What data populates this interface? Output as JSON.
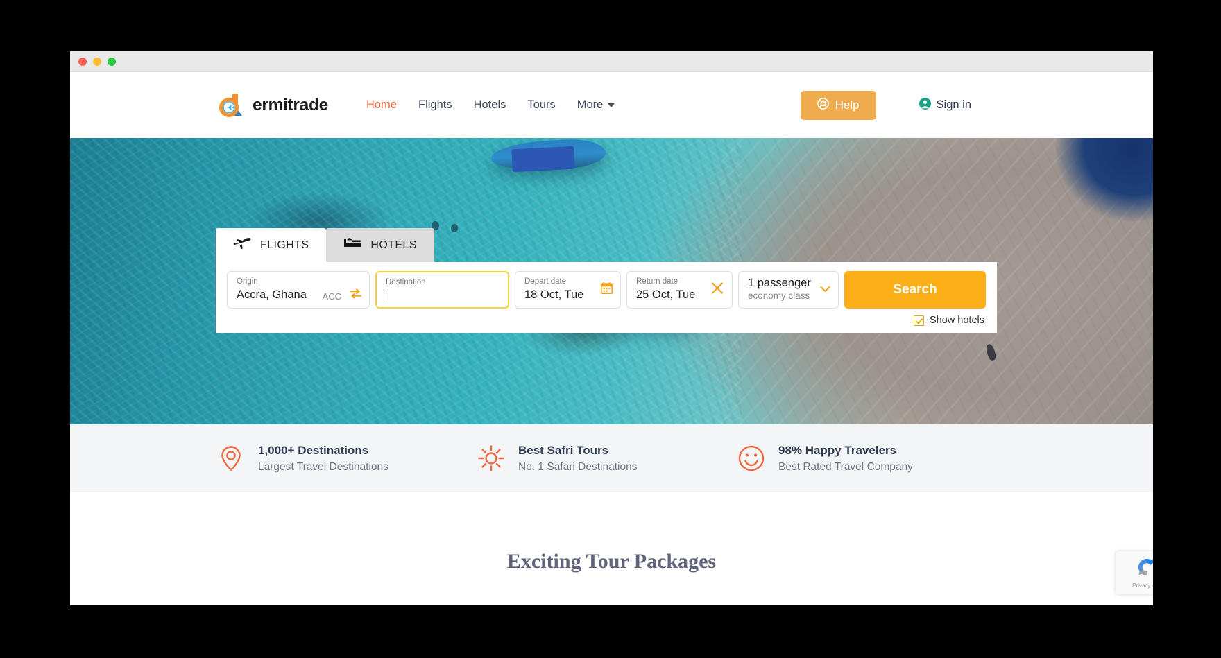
{
  "window": {
    "controls": [
      "close",
      "minimize",
      "maximize"
    ]
  },
  "header": {
    "brand_name": "ermitrade",
    "nav": [
      {
        "label": "Home",
        "active": true
      },
      {
        "label": "Flights",
        "active": false
      },
      {
        "label": "Hotels",
        "active": false
      },
      {
        "label": "Tours",
        "active": false
      },
      {
        "label": "More",
        "active": false,
        "caret": true
      }
    ],
    "help_label": "Help",
    "help_icon": "lifebuoy-icon",
    "signin_label": "Sign in",
    "signin_icon": "user-circle-icon"
  },
  "search": {
    "tabs": [
      {
        "label": "FLIGHTS",
        "icon": "airplane-icon",
        "active": true
      },
      {
        "label": "HOTELS",
        "icon": "bed-icon",
        "active": false
      }
    ],
    "origin": {
      "label": "Origin",
      "value": "Accra, Ghana",
      "code": "ACC",
      "swap_icon": "swap-arrows-icon"
    },
    "destination": {
      "label": "Destination",
      "value": "",
      "placeholder": "Destination",
      "focused": true
    },
    "depart": {
      "label": "Depart date",
      "value": "18 Oct, Tue",
      "icon": "calendar-icon"
    },
    "return": {
      "label": "Return date",
      "value": "25 Oct, Tue",
      "icon": "close-x-icon"
    },
    "passengers": {
      "count_label": "1 passenger",
      "class_label": "economy class",
      "caret_icon": "chevron-down-icon"
    },
    "search_button_label": "Search",
    "show_hotels_label": "Show hotels",
    "show_hotels_checked": true
  },
  "features": [
    {
      "icon": "map-pin-icon",
      "title": "1,000+ Destinations",
      "subtitle": "Largest Travel Destinations"
    },
    {
      "icon": "sun-icon",
      "title": "Best Safri Tours",
      "subtitle": "No. 1 Safari Destinations"
    },
    {
      "icon": "smiley-face-icon",
      "title": "98% Happy Travelers",
      "subtitle": "Best Rated Travel Company"
    }
  ],
  "lower": {
    "section_heading": "Exciting Tour Packages"
  },
  "recaptcha": {
    "terms": "Privacy - Te"
  },
  "colors": {
    "brand_orange": "#f2683c",
    "accent_yellow": "#fcaf17",
    "help_orange": "#eeac4e",
    "nav_text": "#3d4a5c",
    "signin_green": "#16a085",
    "feature_icon": "#f2683c",
    "feature_title": "#2e3a4f",
    "features_bg": "#f4f5f7"
  }
}
